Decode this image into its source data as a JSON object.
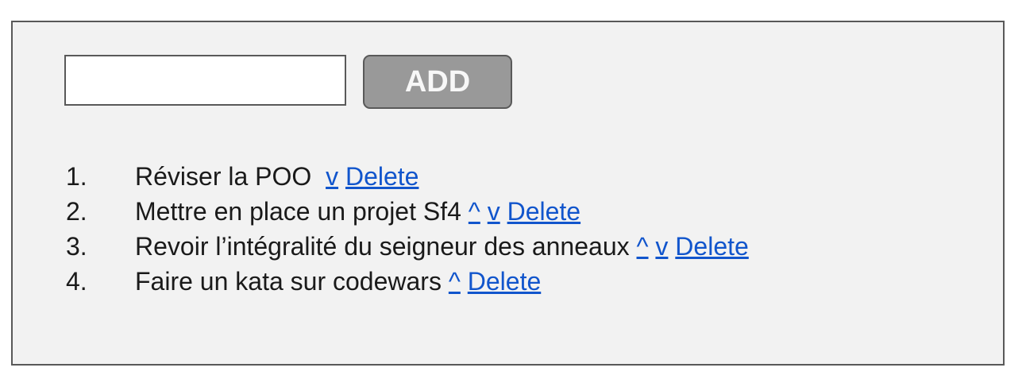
{
  "form": {
    "input_value": "",
    "add_label": "ADD"
  },
  "todos": [
    {
      "number": "1.",
      "text": "Réviser la POO",
      "up": null,
      "down": "v",
      "delete": "Delete"
    },
    {
      "number": "2.",
      "text": "Mettre en place un projet Sf4",
      "up": "^",
      "down": "v",
      "delete": "Delete"
    },
    {
      "number": "3.",
      "text": "Revoir l’intégralité du seigneur des anneaux",
      "up": "^",
      "down": "v",
      "delete": "Delete"
    },
    {
      "number": "4.",
      "text": "Faire un kata sur codewars",
      "up": "^",
      "down": null,
      "delete": "Delete"
    }
  ],
  "colors": {
    "link": "#1155cc",
    "button_bg": "#999999",
    "panel_bg": "#f2f2f2",
    "border": "#595959"
  }
}
